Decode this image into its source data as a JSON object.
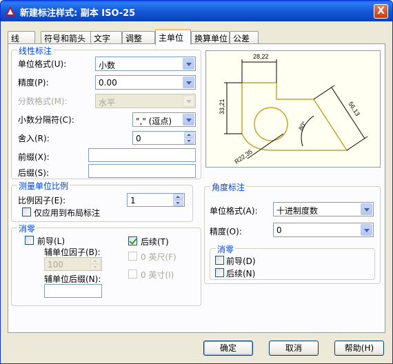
{
  "dialog": {
    "title": "新建标注样式: 副本 ISO-25",
    "close_label": "X"
  },
  "tabs": [
    {
      "label": "线"
    },
    {
      "label": "符号和箭头"
    },
    {
      "label": "文字"
    },
    {
      "label": "调整"
    },
    {
      "label": "主单位"
    },
    {
      "label": "换算单位"
    },
    {
      "label": "公差"
    }
  ],
  "active_tab": "主单位",
  "linear": {
    "group_label": "线性标注",
    "unit_format": {
      "label": "单位格式(U):",
      "value": "小数"
    },
    "precision": {
      "label": "精度(P):",
      "value": "0.00"
    },
    "fraction_format": {
      "label": "分数格式(M):",
      "value": "水平"
    },
    "decimal_separator": {
      "label": "小数分隔符(C):",
      "value": "\",\" (逗点)"
    },
    "round_off": {
      "label": "舍入(R):",
      "value": "0"
    },
    "prefix": {
      "label": "前缀(X):",
      "value": ""
    },
    "suffix": {
      "label": "后缀(S):",
      "value": ""
    }
  },
  "scale": {
    "group_label": "测量单位比例",
    "factor": {
      "label": "比例因子(E):",
      "value": "1"
    },
    "layout_only": {
      "label": "仅应用到布局标注",
      "checked": false
    }
  },
  "zero_suppression_linear": {
    "group_label": "消零",
    "leading": {
      "label": "前导(L)",
      "checked": false
    },
    "trailing": {
      "label": "后续(T)",
      "checked": true
    },
    "sub_unit_factor": {
      "label": "辅单位因子(B):",
      "value": "100"
    },
    "sub_unit_suffix": {
      "label": "辅单位后缀(N):",
      "value": ""
    },
    "feet": {
      "label": "0 英尺(F)",
      "checked": false
    },
    "inches": {
      "label": "0 英寸(I)",
      "checked": false
    }
  },
  "angular": {
    "group_label": "角度标注",
    "unit_format": {
      "label": "单位格式(A):",
      "value": "十进制度数"
    },
    "precision": {
      "label": "精度(O):",
      "value": "0"
    },
    "zero_group_label": "消零",
    "leading": {
      "label": "前导(D)",
      "checked": false
    },
    "trailing": {
      "label": "后续(N)",
      "checked": false
    }
  },
  "preview": {
    "dim_top": "28,22",
    "dim_left": "33,21",
    "dim_slant": "56,13",
    "dim_angle": "80°",
    "dim_radius": "R22,35",
    "line_color": "#c9a227"
  },
  "buttons": {
    "ok": "确定",
    "cancel": "取消",
    "help": "帮助(H)"
  }
}
